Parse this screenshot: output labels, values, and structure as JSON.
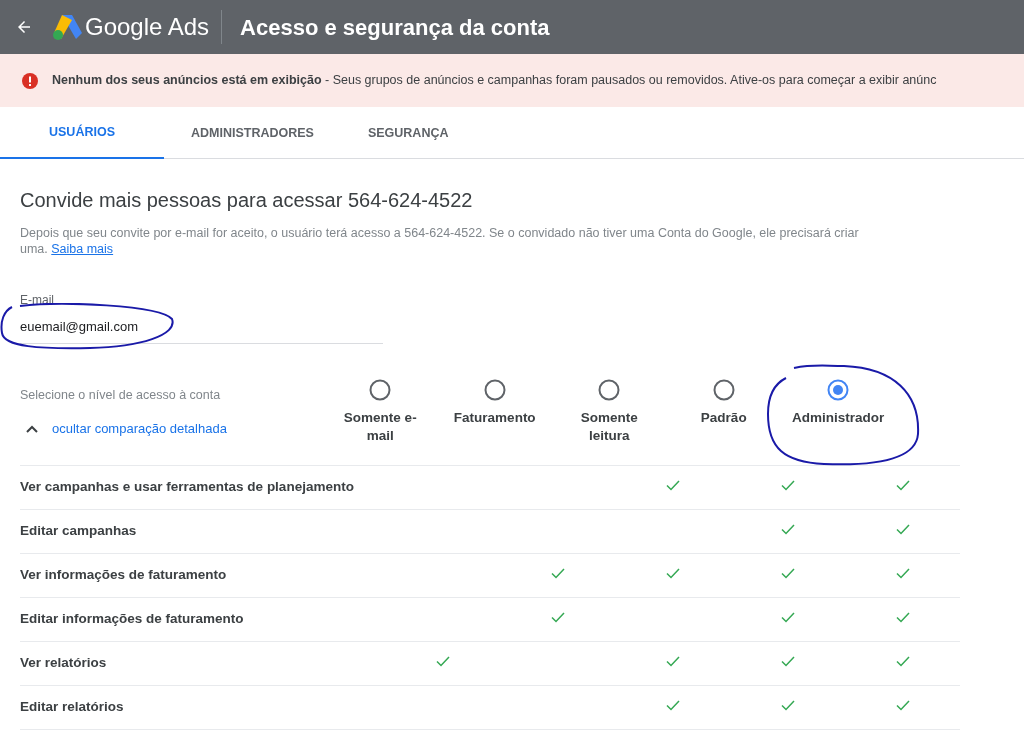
{
  "header": {
    "product": "Google Ads",
    "title": "Acesso e segurança da conta"
  },
  "banner": {
    "text": "**Nenhum dos seus anúncios está em exibição** - Seus grupos de anúncios e campanhas foram pausados ou removidos. Ative-os para começar a exibir anúnc"
  },
  "tabs": [
    {
      "label": "USUÁRIOS",
      "selected": true
    },
    {
      "label": "ADMINISTRADORES",
      "selected": false
    },
    {
      "label": "SEGURANÇA",
      "selected": false
    }
  ],
  "invite": {
    "title": "Convide mais pessoas para acessar 564-624-4522",
    "description": "Depois que seu convite por e-mail for aceito, o usuário terá acesso a 564-624-4522. Se o convidado não tiver uma Conta do Google, ele precisará criar uma.",
    "link": "Saiba mais"
  },
  "email_field": {
    "label": "E-mail",
    "value": "euemail@gmail.com"
  },
  "access": {
    "prompt": "Selecione o nível de acesso à conta",
    "toggle": "ocultar comparação detalhada",
    "options": [
      {
        "label": "Somente e-mail",
        "selected": false
      },
      {
        "label": "Faturamento",
        "selected": false
      },
      {
        "label": "Somente leitura",
        "selected": false
      },
      {
        "label": "Padrão",
        "selected": false
      },
      {
        "label": "Administrador",
        "selected": true
      }
    ]
  },
  "permissions": [
    {
      "label": "Ver campanhas e usar ferramentas de planejamento",
      "checks": [
        false,
        false,
        true,
        true,
        true
      ]
    },
    {
      "label": "Editar campanhas",
      "checks": [
        false,
        false,
        false,
        true,
        true
      ]
    },
    {
      "label": "Ver informações de faturamento",
      "checks": [
        false,
        true,
        true,
        true,
        true
      ]
    },
    {
      "label": "Editar informações de faturamento",
      "checks": [
        false,
        true,
        false,
        true,
        true
      ]
    },
    {
      "label": "Ver relatórios",
      "checks": [
        true,
        false,
        true,
        true,
        true
      ]
    },
    {
      "label": "Editar relatórios",
      "checks": [
        false,
        false,
        true,
        true,
        true
      ]
    }
  ]
}
